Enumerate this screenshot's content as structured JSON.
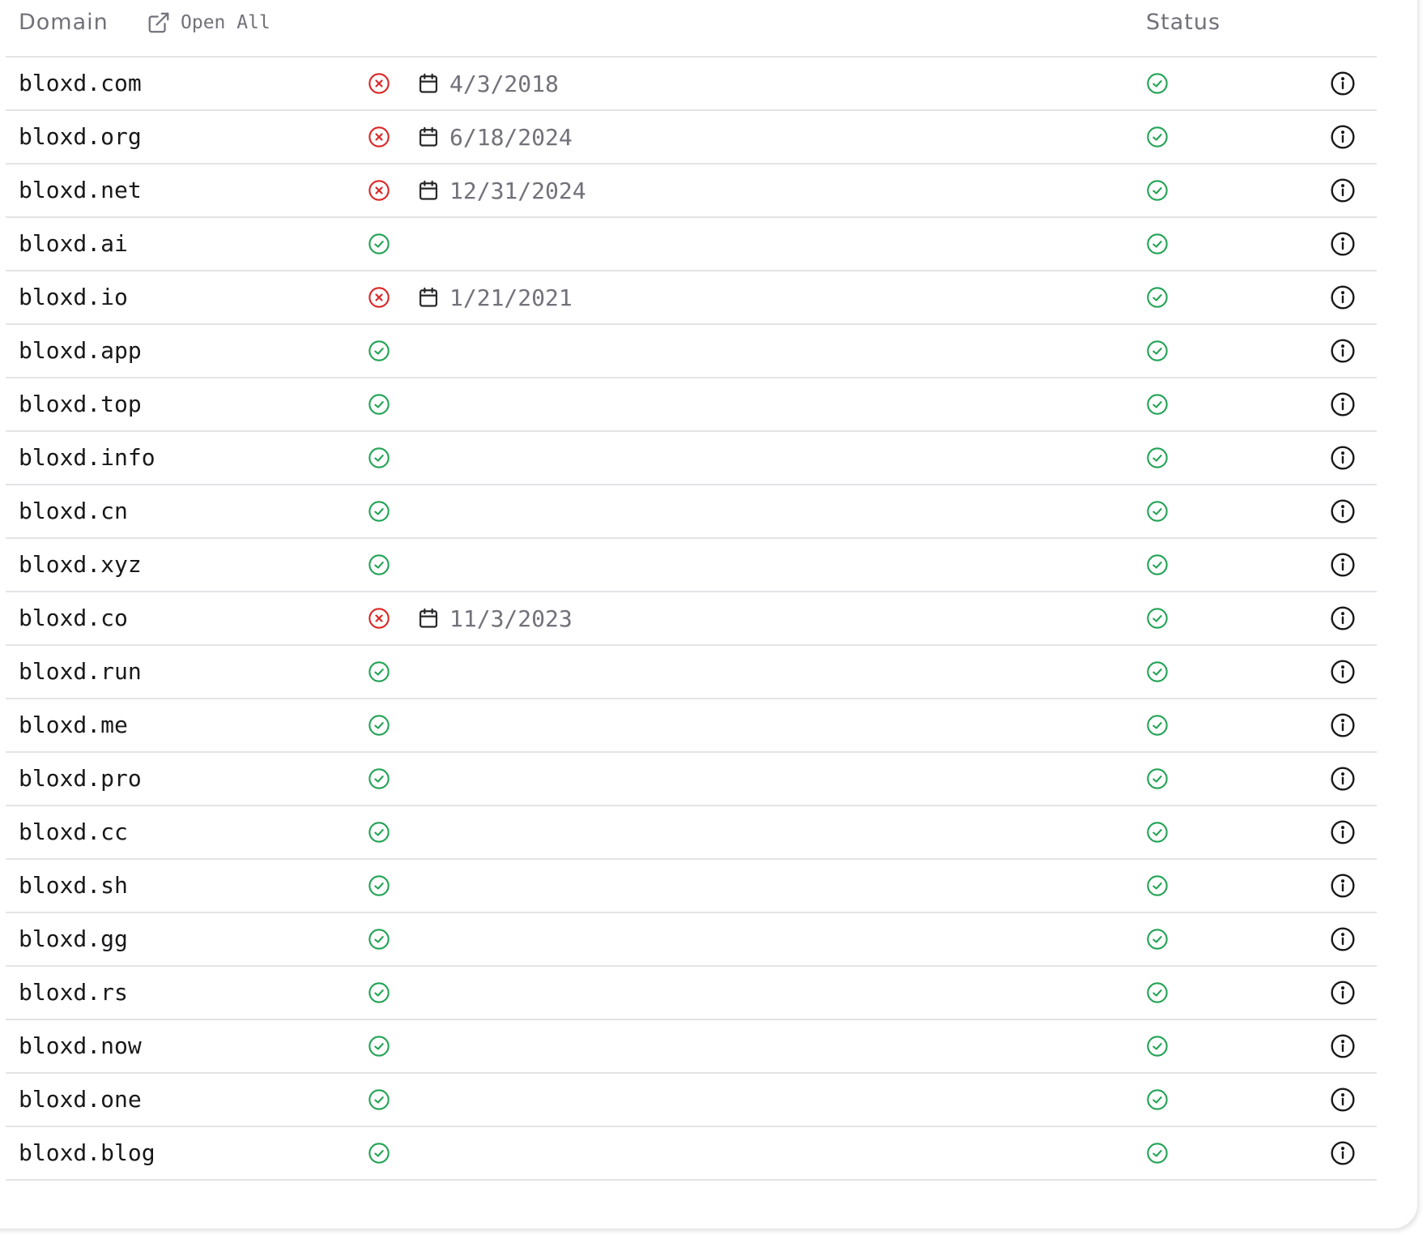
{
  "header": {
    "domain_label": "Domain",
    "open_all_label": "Open All",
    "status_label": "Status"
  },
  "colors": {
    "available": "#22a355",
    "taken": "#dc2626",
    "muted": "#71717a",
    "text": "#18181b"
  },
  "rows": [
    {
      "domain": "bloxd.com",
      "registered": true,
      "date": "4/3/2018",
      "status": "ok"
    },
    {
      "domain": "bloxd.org",
      "registered": true,
      "date": "6/18/2024",
      "status": "ok"
    },
    {
      "domain": "bloxd.net",
      "registered": true,
      "date": "12/31/2024",
      "status": "ok"
    },
    {
      "domain": "bloxd.ai",
      "registered": false,
      "date": "",
      "status": "ok"
    },
    {
      "domain": "bloxd.io",
      "registered": true,
      "date": "1/21/2021",
      "status": "ok"
    },
    {
      "domain": "bloxd.app",
      "registered": false,
      "date": "",
      "status": "ok"
    },
    {
      "domain": "bloxd.top",
      "registered": false,
      "date": "",
      "status": "ok"
    },
    {
      "domain": "bloxd.info",
      "registered": false,
      "date": "",
      "status": "ok"
    },
    {
      "domain": "bloxd.cn",
      "registered": false,
      "date": "",
      "status": "ok"
    },
    {
      "domain": "bloxd.xyz",
      "registered": false,
      "date": "",
      "status": "ok"
    },
    {
      "domain": "bloxd.co",
      "registered": true,
      "date": "11/3/2023",
      "status": "ok"
    },
    {
      "domain": "bloxd.run",
      "registered": false,
      "date": "",
      "status": "ok"
    },
    {
      "domain": "bloxd.me",
      "registered": false,
      "date": "",
      "status": "ok"
    },
    {
      "domain": "bloxd.pro",
      "registered": false,
      "date": "",
      "status": "ok"
    },
    {
      "domain": "bloxd.cc",
      "registered": false,
      "date": "",
      "status": "ok"
    },
    {
      "domain": "bloxd.sh",
      "registered": false,
      "date": "",
      "status": "ok"
    },
    {
      "domain": "bloxd.gg",
      "registered": false,
      "date": "",
      "status": "ok"
    },
    {
      "domain": "bloxd.rs",
      "registered": false,
      "date": "",
      "status": "ok"
    },
    {
      "domain": "bloxd.now",
      "registered": false,
      "date": "",
      "status": "ok"
    },
    {
      "domain": "bloxd.one",
      "registered": false,
      "date": "",
      "status": "ok"
    },
    {
      "domain": "bloxd.blog",
      "registered": false,
      "date": "",
      "status": "ok"
    }
  ]
}
